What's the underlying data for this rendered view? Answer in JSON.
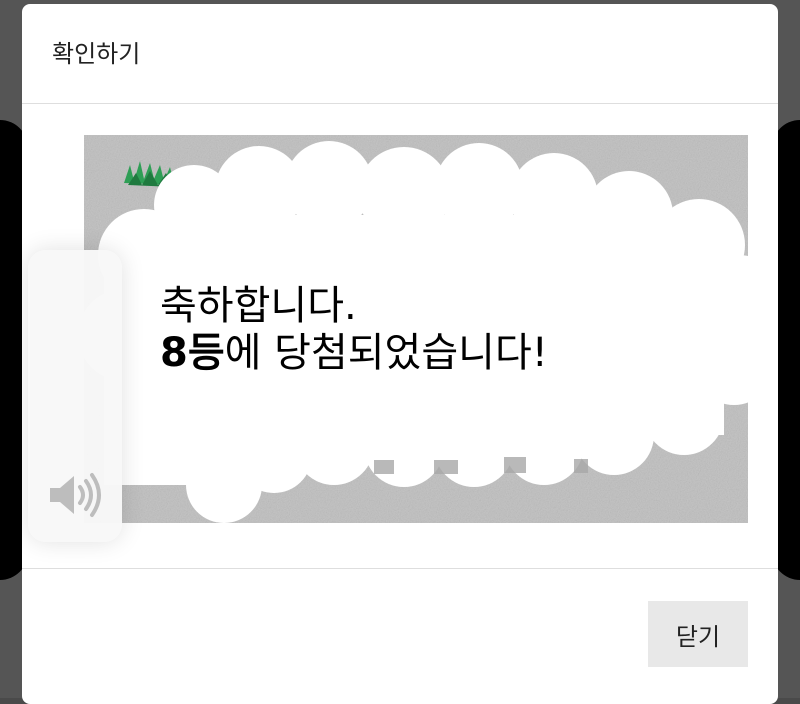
{
  "dialog": {
    "title": "확인하기",
    "prize": {
      "line1": "축하합니다.",
      "rank": "8등",
      "line2_rest": "에 당첨되었습니다!"
    },
    "close_label": "닫기"
  },
  "volume": {
    "icon": "speaker-volume-icon"
  },
  "colors": {
    "scratch_surface": "#c9c9c9",
    "close_button_bg": "#e8e8e8",
    "divider": "#dedede"
  }
}
